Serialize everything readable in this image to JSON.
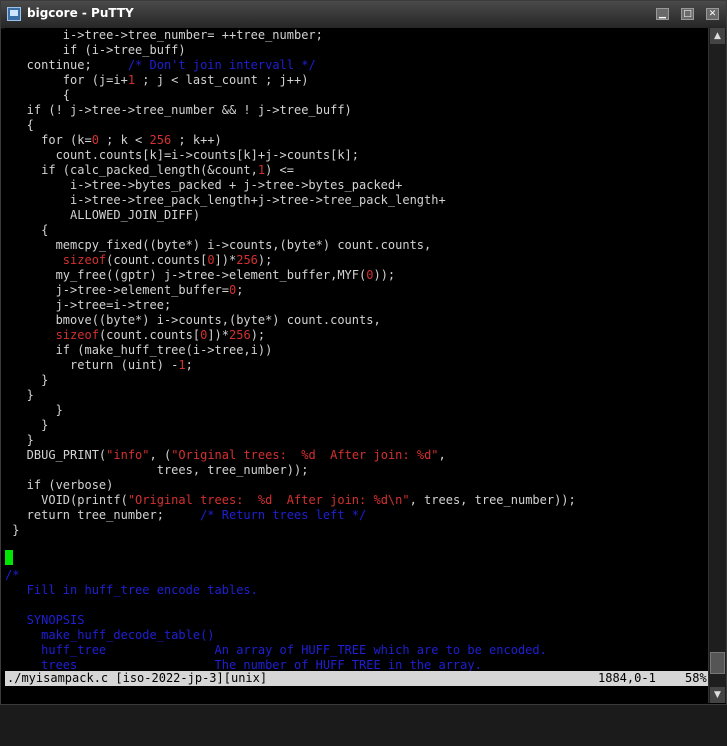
{
  "window": {
    "title": "bigcore - PuTTY"
  },
  "controls": {
    "minimize": "▁",
    "maximize": "□",
    "close": "✕"
  },
  "scroll": {
    "up": "▲",
    "down": "▼",
    "position_percent": 58
  },
  "colors": {
    "comment": "#1f1fd6",
    "string": "#d43030",
    "number": "#d43030",
    "text": "#d2d2d2",
    "cursor": "#00e600",
    "status_bg": "#d6d6d6"
  },
  "editor": {
    "lines": [
      [
        {
          "t": "        i->tree->tree_number= ++tree_number;"
        }
      ],
      [
        {
          "t": "        if (i->tree_buff)"
        }
      ],
      [
        {
          "t": "   continue;     "
        },
        {
          "t": "/* Don't join intervall */",
          "k": "c"
        }
      ],
      [
        {
          "t": "        for (j=i+"
        },
        {
          "t": "1",
          "k": "n"
        },
        {
          "t": " ; j < last_count ; j++)"
        }
      ],
      [
        {
          "t": "        {"
        }
      ],
      [
        {
          "t": "   if (! j->tree->tree_number && ! j->tree_buff)"
        }
      ],
      [
        {
          "t": "   {"
        }
      ],
      [
        {
          "t": "     for (k="
        },
        {
          "t": "0",
          "k": "n"
        },
        {
          "t": " ; k < "
        },
        {
          "t": "256",
          "k": "n"
        },
        {
          "t": " ; k++)"
        }
      ],
      [
        {
          "t": "       count.counts[k]=i->counts[k]+j->counts[k];"
        }
      ],
      [
        {
          "t": "     if (calc_packed_length(&count,"
        },
        {
          "t": "1",
          "k": "n"
        },
        {
          "t": ") <="
        }
      ],
      [
        {
          "t": "         i->tree->bytes_packed + j->tree->bytes_packed+"
        }
      ],
      [
        {
          "t": "         i->tree->tree_pack_length+j->tree->tree_pack_length+"
        }
      ],
      [
        {
          "t": "         ALLOWED_JOIN_DIFF)"
        }
      ],
      [
        {
          "t": "     {"
        }
      ],
      [
        {
          "t": "       memcpy_fixed((byte*) i->counts,(byte*) count.counts,"
        }
      ],
      [
        {
          "t": "        "
        },
        {
          "t": "sizeof",
          "k": "n"
        },
        {
          "t": "(count.counts["
        },
        {
          "t": "0",
          "k": "n"
        },
        {
          "t": "])*"
        },
        {
          "t": "256",
          "k": "n"
        },
        {
          "t": ");"
        }
      ],
      [
        {
          "t": "       my_free((gptr) j->tree->element_buffer,MYF("
        },
        {
          "t": "0",
          "k": "n"
        },
        {
          "t": "));"
        }
      ],
      [
        {
          "t": "       j->tree->element_buffer="
        },
        {
          "t": "0",
          "k": "n"
        },
        {
          "t": ";"
        }
      ],
      [
        {
          "t": "       j->tree=i->tree;"
        }
      ],
      [
        {
          "t": "       bmove((byte*) i->counts,(byte*) count.counts,"
        }
      ],
      [
        {
          "t": "       "
        },
        {
          "t": "sizeof",
          "k": "n"
        },
        {
          "t": "(count.counts["
        },
        {
          "t": "0",
          "k": "n"
        },
        {
          "t": "])*"
        },
        {
          "t": "256",
          "k": "n"
        },
        {
          "t": ");"
        }
      ],
      [
        {
          "t": "       if (make_huff_tree(i->tree,i))"
        }
      ],
      [
        {
          "t": "         return (uint) -"
        },
        {
          "t": "1",
          "k": "n"
        },
        {
          "t": ";"
        }
      ],
      [
        {
          "t": "     }"
        }
      ],
      [
        {
          "t": "   }"
        }
      ],
      [
        {
          "t": "       }"
        }
      ],
      [
        {
          "t": "     }"
        }
      ],
      [
        {
          "t": "   }"
        }
      ],
      [
        {
          "t": "   DBUG_PRINT("
        },
        {
          "t": "\"info\"",
          "k": "s"
        },
        {
          "t": ", ("
        },
        {
          "t": "\"Original trees:  %d  After join: %d\"",
          "k": "s"
        },
        {
          "t": ","
        }
      ],
      [
        {
          "t": "                     trees, tree_number));"
        }
      ],
      [
        {
          "t": "   if (verbose)"
        }
      ],
      [
        {
          "t": "     VOID(printf("
        },
        {
          "t": "\"Original trees:  %d  After join: %d\\n\"",
          "k": "s"
        },
        {
          "t": ", trees, tree_number));"
        }
      ],
      [
        {
          "t": "   return tree_number;     "
        },
        {
          "t": "/* Return trees left */",
          "k": "c"
        }
      ],
      [
        {
          "t": " }"
        }
      ],
      [
        {
          "t": ""
        }
      ],
      [
        {
          "t": ""
        }
      ],
      [
        {
          "t": "/*",
          "k": "c"
        }
      ],
      [
        {
          "t": "   Fill in huff_tree encode tables.",
          "k": "c"
        }
      ],
      [
        {
          "t": "",
          "k": "c"
        }
      ],
      [
        {
          "t": "   SYNOPSIS",
          "k": "c"
        }
      ],
      [
        {
          "t": "     make_huff_decode_table()",
          "k": "c"
        }
      ],
      [
        {
          "t": "     huff_tree               An array of HUFF_TREE which are to be encoded.",
          "k": "c"
        }
      ],
      [
        {
          "t": "     trees                   The number of HUFF_TREE in the array.",
          "k": "c"
        }
      ]
    ]
  },
  "status": {
    "file": "./myisampack.c [iso-2022-jp-3][unix]",
    "position": "1884,0-1",
    "percent": "58%"
  }
}
